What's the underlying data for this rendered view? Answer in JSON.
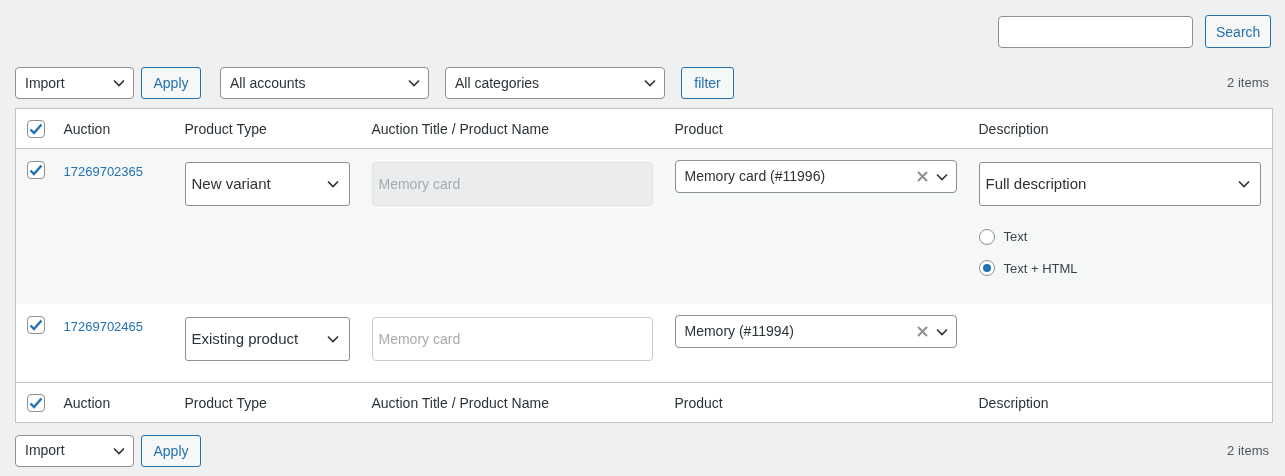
{
  "search": {
    "button": "Search"
  },
  "top_toolbar": {
    "bulk_action": "Import",
    "apply": "Apply",
    "accounts": "All accounts",
    "categories": "All categories",
    "filter": "filter",
    "count": "2 items"
  },
  "table": {
    "header": {
      "checked": true,
      "columns": [
        "Auction",
        "Product Type",
        "Auction Title / Product Name",
        "Product",
        "Description"
      ]
    },
    "rows": [
      {
        "selected": true,
        "auction": "17269702365",
        "product_type": "New variant",
        "title": {
          "placeholder": "Memory card",
          "disabled": true
        },
        "product": "Memory card (#11996)",
        "description": {
          "mode": "Full description",
          "options": [
            {
              "label": "Text",
              "selected": false
            },
            {
              "label": "Text + HTML",
              "selected": true
            }
          ]
        }
      },
      {
        "selected": true,
        "auction": "17269702465",
        "product_type": "Existing product",
        "title": {
          "placeholder": "Memory card",
          "disabled": false
        },
        "product": "Memory (#11994)"
      }
    ],
    "footer": {
      "checked": true,
      "columns": [
        "Auction",
        "Product Type",
        "Auction Title / Product Name",
        "Product",
        "Description"
      ]
    }
  },
  "bottom_toolbar": {
    "bulk_action": "Import",
    "apply": "Apply",
    "count": "2 items"
  }
}
